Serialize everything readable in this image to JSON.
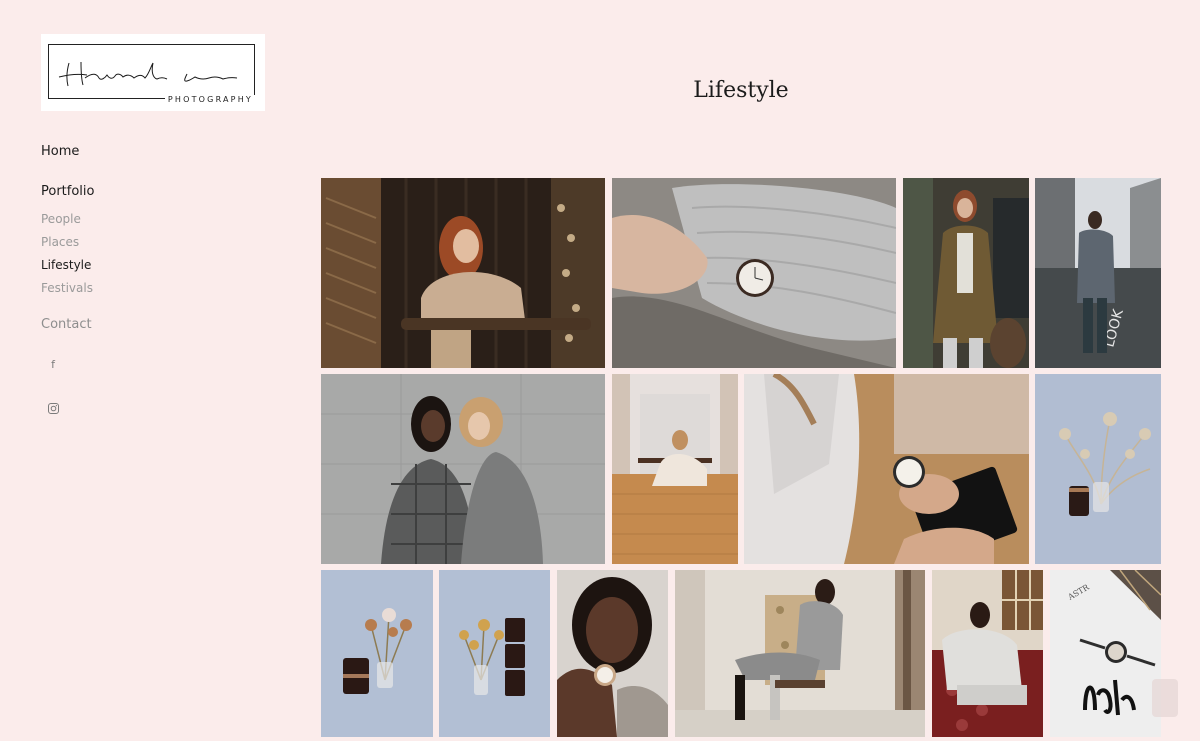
{
  "logo": {
    "signature": "Hannah Lees",
    "subtitle": "PHOTOGRAPHY"
  },
  "nav": {
    "home": "Home",
    "portfolio": "Portfolio",
    "people": "People",
    "places": "Places",
    "lifestyle": "Lifestyle",
    "festivals": "Festivals",
    "contact": "Contact"
  },
  "social": {
    "facebook": "f",
    "instagram": "instagram-icon"
  },
  "page": {
    "title": "Lifestyle"
  },
  "gallery": [
    {
      "name": "photo-woman-at-cafe-table"
    },
    {
      "name": "photo-watch-on-knit-sleeve"
    },
    {
      "name": "photo-woman-in-olive-coat"
    },
    {
      "name": "photo-woman-on-street-look"
    },
    {
      "name": "photo-two-women-embracing"
    },
    {
      "name": "photo-woman-sitting-on-floor"
    },
    {
      "name": "photo-watch-in-gift-box"
    },
    {
      "name": "photo-dried-flowers-and-candle"
    },
    {
      "name": "photo-flowers-and-candle-jar"
    },
    {
      "name": "photo-flowers-and-candle-stack"
    },
    {
      "name": "photo-woman-portrait-with-watch"
    },
    {
      "name": "photo-woman-seated-in-chair"
    },
    {
      "name": "photo-woman-on-red-sofa"
    },
    {
      "name": "photo-watch-on-magazine"
    }
  ]
}
